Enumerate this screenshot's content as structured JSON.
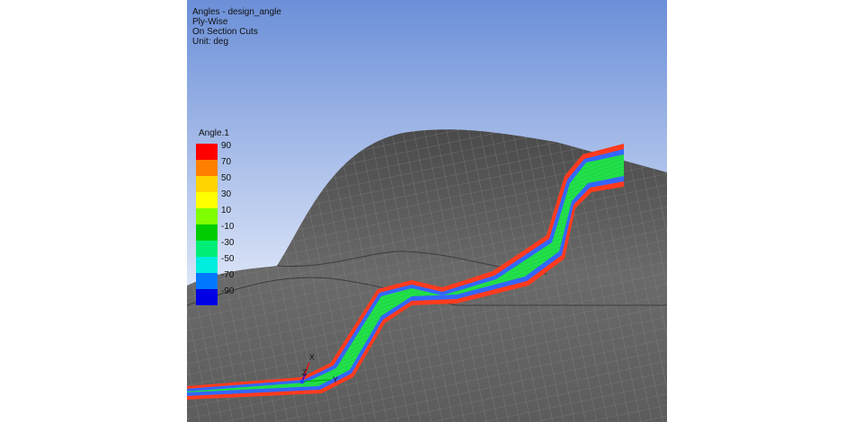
{
  "header": {
    "line1": "Angles - design_angle",
    "line2": "Ply-Wise",
    "line3": "On Section Cuts",
    "line4": "Unit: deg"
  },
  "legend": {
    "title": "Angle.1",
    "entries": [
      {
        "label": "90",
        "color": "#ff0000"
      },
      {
        "label": "70",
        "color": "#ff7f00"
      },
      {
        "label": "50",
        "color": "#ffd400"
      },
      {
        "label": "30",
        "color": "#ffff00"
      },
      {
        "label": "10",
        "color": "#7fff00"
      },
      {
        "label": "-10",
        "color": "#00cc00"
      },
      {
        "label": "-30",
        "color": "#00ee77"
      },
      {
        "label": "-50",
        "color": "#00eedd"
      },
      {
        "label": "-70",
        "color": "#0077ff"
      },
      {
        "label": "-90",
        "color": "#0000e6"
      }
    ]
  },
  "triad": {
    "x": "X",
    "y": "Y",
    "z": "Z"
  },
  "colors": {
    "sky_top": "#6b8fd8",
    "sky_bottom": "#ffffff",
    "mesh": "#5a5a5a",
    "ply_outer": "#ff3b1e",
    "ply_blue": "#3366ff",
    "ply_core": "#22e04a"
  }
}
